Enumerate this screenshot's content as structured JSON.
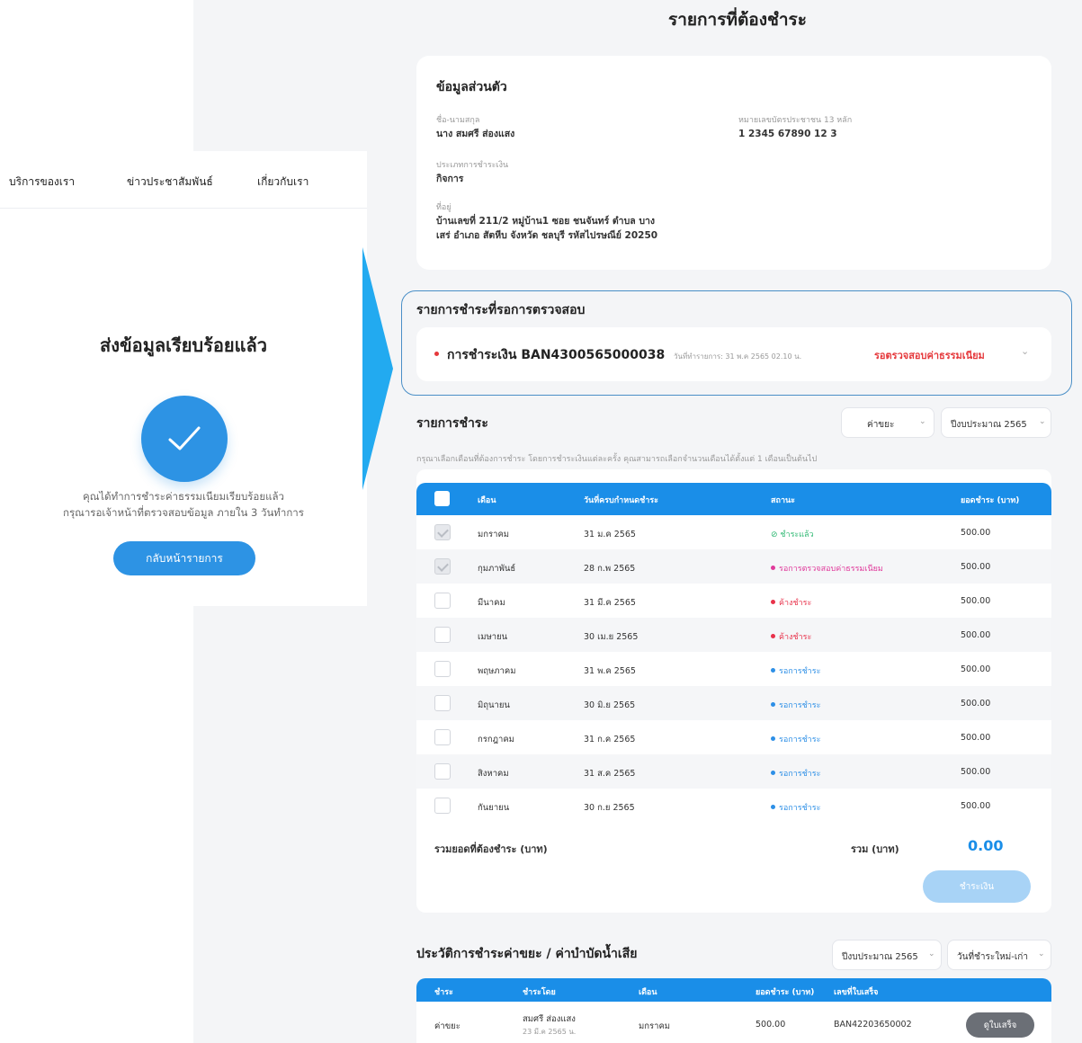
{
  "nav": {
    "services": "บริการของเรา",
    "news": "ข่าวประชาสัมพันธ์",
    "about": "เกี่ยวกับเรา"
  },
  "success": {
    "title": "ส่งข้อมูลเรียบร้อยแล้ว",
    "line1": "คุณได้ทำการชำระค่าธรรมเนียมเรียบร้อยแล้ว",
    "line2": "กรุณารอเจ้าหน้าที่ตรวจสอบข้อมูล ภายใน 3 วันทำการ",
    "back_button": "กลับหน้ารายการ"
  },
  "page": {
    "title": "รายการที่ต้องชำระ"
  },
  "personal": {
    "heading": "ข้อมูลส่วนตัว",
    "name_label": "ชื่อ-นามสกุล",
    "name_value": "นาง สมศรี ส่องแสง",
    "id_label": "หมายเลขบัตรประชาชน 13 หลัก",
    "id_value": "1 2345 67890 12 3",
    "type_label": "ประเภทการชำระเงิน",
    "type_value": "กิจการ",
    "address_label": "ที่อยู่",
    "address_line1": "บ้านเลขที่ 211/2 หมู่บ้าน1 ซอย ชนจันทร์ ตำบล บาง",
    "address_line2": "เสร่ อำเภอ สัตหีบ จังหวัด ชลบุรี รหัสไปรษณีย์ 20250"
  },
  "pending": {
    "heading": "รายการชำระที่รอการตรวจสอบ",
    "item_title": "การชำระเงิน BAN4300565000038",
    "item_date": "วันที่ทำรายการ: 31 พ.ค 2565 02.10 น.",
    "item_status": "รอตรวจสอบค่าธรรมเนียม"
  },
  "payments": {
    "heading": "รายการชำระ",
    "filter_type": "ค่าขยะ",
    "filter_year": "ปีงบประมาณ 2565",
    "hint": "กรุณาเลือกเดือนที่ต้องการชำระ โดยการชำระเงินแต่ละครั้ง คุณสามารถเลือกจำนวนเดือนได้ตั้งแต่ 1 เดือนเป็นต้นไป",
    "columns": [
      "เดือน",
      "วันที่ครบกำหนดชำระ",
      "สถานะ",
      "ยอดชำระ (บาท)"
    ],
    "rows": [
      {
        "month": "มกราคม",
        "due": "31 ม.ค 2565",
        "status": "ชำระแล้ว",
        "amount": "500.00"
      },
      {
        "month": "กุมภาพันธ์",
        "due": "28 ก.พ 2565",
        "status": "รอการตรวจสอบค่าธรรมเนียม",
        "amount": "500.00"
      },
      {
        "month": "มีนาคม",
        "due": "31 มี.ค 2565",
        "status": "ค้างชำระ",
        "amount": "500.00"
      },
      {
        "month": "เมษายน",
        "due": "30 เม.ย 2565",
        "status": "ค้างชำระ",
        "amount": "500.00"
      },
      {
        "month": "พฤษภาคม",
        "due": "31 พ.ค 2565",
        "status": "รอการชำระ",
        "amount": "500.00"
      },
      {
        "month": "มิถุนายน",
        "due": "30 มิ.ย 2565",
        "status": "รอการชำระ",
        "amount": "500.00"
      },
      {
        "month": "กรกฎาคม",
        "due": "31 ก.ค 2565",
        "status": "รอการชำระ",
        "amount": "500.00"
      },
      {
        "month": "สิงหาคม",
        "due": "31 ส.ค 2565",
        "status": "รอการชำระ",
        "amount": "500.00"
      },
      {
        "month": "กันยายน",
        "due": "30 ก.ย 2565",
        "status": "รอการชำระ",
        "amount": "500.00"
      }
    ],
    "total_label": "รวมยอดที่ต้องชำระ (บาท)",
    "sum_label": "รวม (บาท)",
    "sum_value": "0.00",
    "pay_button": "ชำระเงิน"
  },
  "history": {
    "heading": "ประวัติการชำระค่าขยะ / ค่าบำบัดน้ำเสีย",
    "filter_year": "ปีงบประมาณ 2565",
    "filter_sort": "วันที่ชำระใหม่-เก่า",
    "columns": [
      "ชำระ",
      "ชำระโดย",
      "เดือน",
      "ยอดชำระ (บาท)",
      "เลขที่ใบเสร็จ"
    ],
    "row": {
      "type": "ค่าขยะ",
      "payer": "สมศรี ส่องแสง",
      "payer_date": "23 มี.ค 2565 น.",
      "month": "มกราคม",
      "amount": "500.00",
      "receipt_no": "BAN42203650002",
      "receipt_button": "ดูใบเสร็จ"
    }
  },
  "colors": {
    "primary": "#1a8ee8",
    "paid": "#2eb872",
    "reviewing": "#e03a9b",
    "overdue": "#e8314a",
    "waiting": "#2d8fe6",
    "pending_status": "#e5383b"
  }
}
